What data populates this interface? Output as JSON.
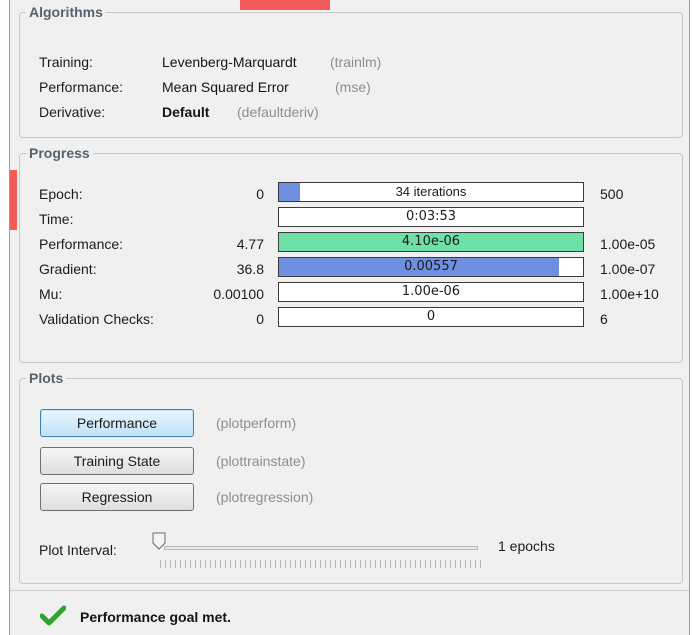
{
  "algorithms": {
    "title": "Algorithms",
    "rows": [
      {
        "label": "Training:",
        "value": "Levenberg-Marquardt",
        "code": "(trainlm)"
      },
      {
        "label": "Performance:",
        "value": "Mean Squared Error",
        "code": "(mse)"
      },
      {
        "label": "Derivative:",
        "value": "Default",
        "code": "(defaultderiv)"
      }
    ]
  },
  "progress": {
    "title": "Progress",
    "rows": [
      {
        "label": "Epoch:",
        "start": "0",
        "bar_text": "34 iterations",
        "end": "500",
        "fill_fraction": 0.068,
        "fill_color": "#6f8fe0"
      },
      {
        "label": "Time:",
        "start": "",
        "bar_text": "0:03:53",
        "end": "",
        "fill_fraction": 0,
        "fill_color": ""
      },
      {
        "label": "Performance:",
        "start": "4.77",
        "bar_text": "4.10e-06",
        "end": "1.00e-05",
        "fill_fraction": 1.0,
        "fill_color": "#6ee0a8"
      },
      {
        "label": "Gradient:",
        "start": "36.8",
        "bar_text": "0.00557",
        "end": "1.00e-07",
        "fill_fraction": 0.92,
        "fill_color": "#6f8fe0"
      },
      {
        "label": "Mu:",
        "start": "0.00100",
        "bar_text": "1.00e-06",
        "end": "1.00e+10",
        "fill_fraction": 0,
        "fill_color": ""
      },
      {
        "label": "Validation Checks:",
        "start": "0",
        "bar_text": "0",
        "end": "6",
        "fill_fraction": 0,
        "fill_color": ""
      }
    ]
  },
  "plots": {
    "title": "Plots",
    "buttons": [
      {
        "label": "Performance",
        "code": "(plotperform)"
      },
      {
        "label": "Training State",
        "code": "(plottrainstate)"
      },
      {
        "label": "Regression",
        "code": "(plotregression)"
      }
    ],
    "interval_label": "Plot Interval:",
    "interval_value": "1 epochs"
  },
  "status": {
    "message": "Performance goal met.",
    "icon": "checkmark-icon",
    "icon_color": "#2fa52f"
  },
  "colors": {
    "legend_text": "#55626f",
    "accent_red": "#f25a5a"
  }
}
